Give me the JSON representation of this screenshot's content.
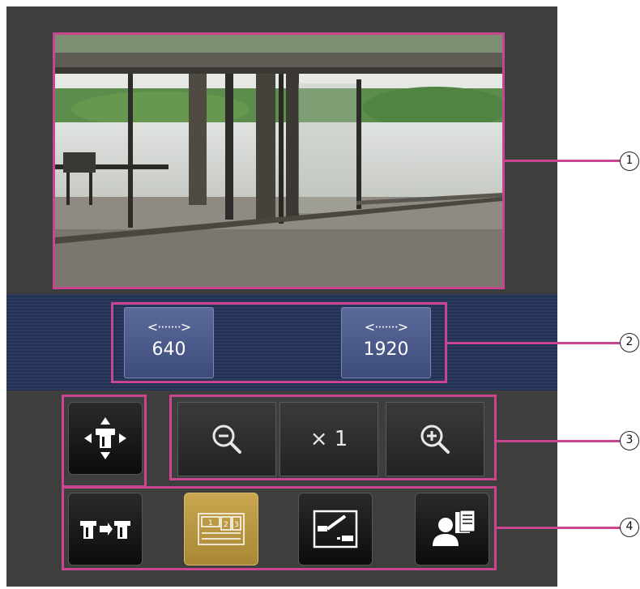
{
  "resolution": {
    "buttons": [
      {
        "arrow": "<·······>",
        "label": "640"
      },
      {
        "arrow": "<·······>",
        "label": "1920"
      }
    ]
  },
  "zoom": {
    "zoom_out_icon": "zoom-out-icon",
    "level_label": "× 1",
    "zoom_in_icon": "zoom-in-icon"
  },
  "controls": {
    "pan_tilt_icon": "pan-tilt-control-icon",
    "camera_switch_icon": "camera-switch-icon",
    "multi_screen_icon": "multi-screen-icon",
    "multi_screen_digits": [
      "1",
      "2",
      "3"
    ],
    "snapshot_icon": "camera-settings-icon",
    "user_icon": "user-list-icon"
  },
  "callouts": [
    "1",
    "2",
    "3",
    "4"
  ],
  "colors": {
    "panel": "#3e3e3e",
    "highlight": "#c9458f",
    "band": "#2c3a62",
    "active_button": "#c9a64f"
  }
}
